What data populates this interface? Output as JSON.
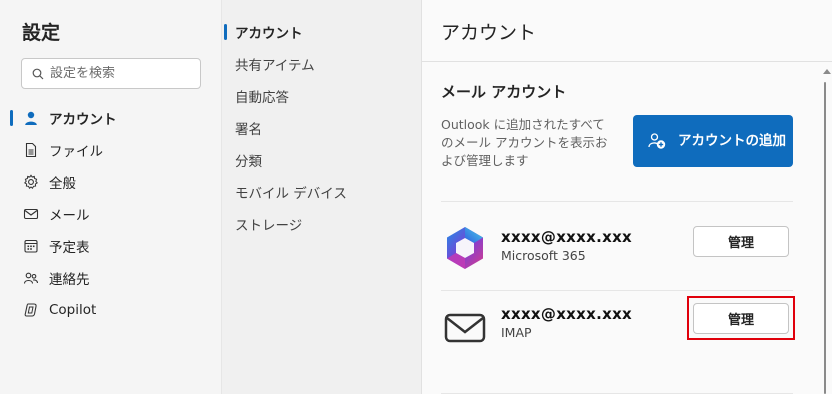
{
  "settings": {
    "title": "設定",
    "search_placeholder": "設定を検索"
  },
  "nav": [
    {
      "label": "アカウント",
      "icon": "person-icon",
      "active": true
    },
    {
      "label": "ファイル",
      "icon": "document-icon"
    },
    {
      "label": "全般",
      "icon": "gear-icon"
    },
    {
      "label": "メール",
      "icon": "mail-icon"
    },
    {
      "label": "予定表",
      "icon": "calendar-icon"
    },
    {
      "label": "連絡先",
      "icon": "people-icon"
    },
    {
      "label": "Copilot",
      "icon": "copilot-icon"
    }
  ],
  "subnav": [
    {
      "label": "アカウント",
      "active": true
    },
    {
      "label": "共有アイテム"
    },
    {
      "label": "自動応答"
    },
    {
      "label": "署名"
    },
    {
      "label": "分類"
    },
    {
      "label": "モバイル デバイス"
    },
    {
      "label": "ストレージ"
    }
  ],
  "panel": {
    "title": "アカウント",
    "section_title": "メール アカウント",
    "description": "Outlook に追加されたすべてのメール アカウントを表示および管理します",
    "add_button_label": "アカウントの追加"
  },
  "accounts": [
    {
      "email": "xxxx@xxxx.xxx",
      "type": "Microsoft 365",
      "logo": "microsoft365-icon",
      "manage_label": "管理"
    },
    {
      "email": "xxxx@xxxx.xxx",
      "type": "IMAP",
      "logo": "mail-icon",
      "manage_label": "管理"
    }
  ],
  "colors": {
    "accent": "#0f6cbd",
    "highlight": "#e0000b"
  }
}
